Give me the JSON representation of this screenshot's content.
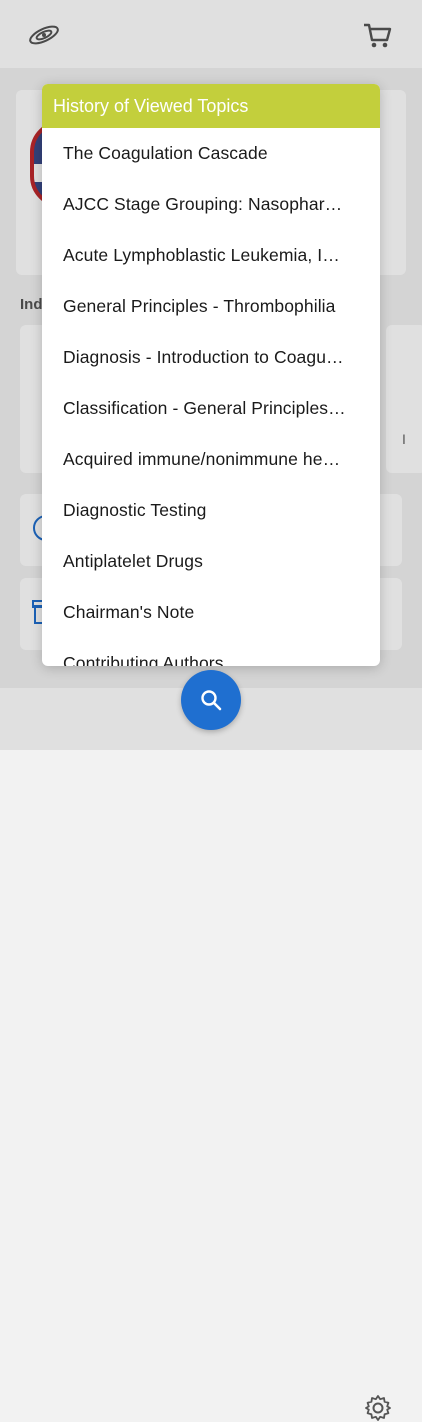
{
  "header": {
    "logo_icon": "galaxy-logo-icon",
    "cart_icon": "shopping-cart-icon"
  },
  "background": {
    "section_title_partial": "Ind",
    "tile_partial_text": "I"
  },
  "modal": {
    "title": "History of Viewed Topics",
    "header_color": "#c3cf3c",
    "items": [
      {
        "label": "The Coagulation Cascade"
      },
      {
        "label": "AJCC Stage Grouping: Nasophar…"
      },
      {
        "label": "Acute Lymphoblastic Leukemia, I…"
      },
      {
        "label": "General Principles - Thrombophilia"
      },
      {
        "label": "Diagnosis - Introduction to Coagu…"
      },
      {
        "label": "Classification - General Principles…"
      },
      {
        "label": "Acquired immune/nonimmune he…"
      },
      {
        "label": "Diagnostic Testing"
      },
      {
        "label": "Antiplatelet Drugs"
      },
      {
        "label": "Chairman's Note"
      },
      {
        "label": "Contributing Authors"
      }
    ]
  },
  "bottom_bar": {
    "search_icon": "search-icon",
    "search_color": "#1f6fd0",
    "settings_icon": "gear-icon"
  }
}
